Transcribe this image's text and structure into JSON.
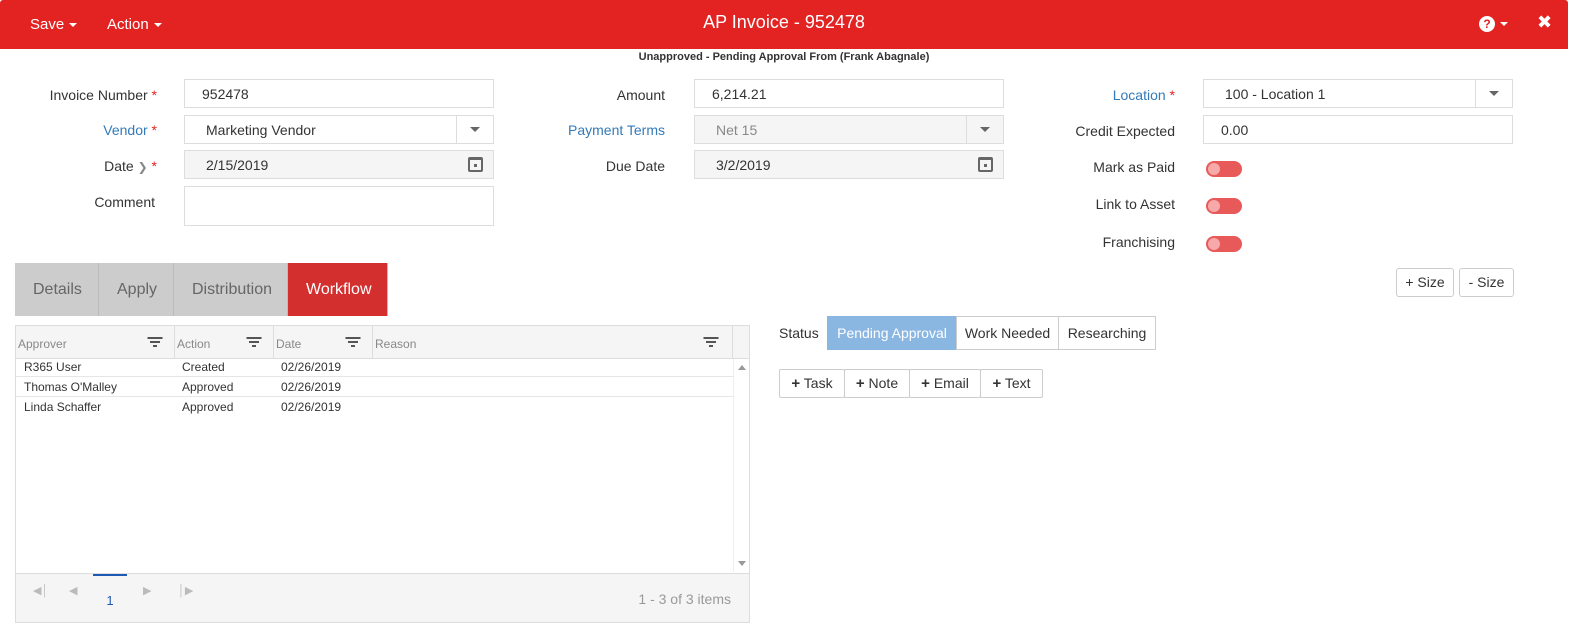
{
  "header": {
    "save_label": "Save",
    "action_label": "Action",
    "title": "AP Invoice - 952478",
    "help_glyph": "?",
    "close_glyph": "✖"
  },
  "status_line": "Unapproved - Pending Approval From (Frank Abagnale)",
  "form": {
    "invoice_number_label": "Invoice Number",
    "invoice_number": "952478",
    "vendor_label": "Vendor",
    "vendor": "Marketing Vendor",
    "date_label": "Date",
    "date": "2/15/2019",
    "comment_label": "Comment",
    "comment": "",
    "amount_label": "Amount",
    "amount": "6,214.21",
    "payment_terms_label": "Payment Terms",
    "payment_terms": "Net 15",
    "due_date_label": "Due Date",
    "due_date": "3/2/2019",
    "location_label": "Location",
    "location": "100 - Location 1",
    "credit_expected_label": "Credit Expected",
    "credit_expected": "0.00",
    "mark_as_paid_label": "Mark as Paid",
    "link_to_asset_label": "Link to Asset",
    "franchising_label": "Franchising",
    "required_mark": "*",
    "toggles": {
      "mark_as_paid": false,
      "link_to_asset": false,
      "franchising": false
    }
  },
  "size_buttons": {
    "plus": "+ Size",
    "minus": "- Size"
  },
  "tabs": [
    {
      "label": "Details"
    },
    {
      "label": "Apply"
    },
    {
      "label": "Distribution"
    },
    {
      "label": "Workflow",
      "active": true
    }
  ],
  "grid": {
    "columns": [
      "Approver",
      "Action",
      "Date",
      "Reason"
    ],
    "rows": [
      {
        "approver": "R365 User",
        "action": "Created",
        "date": "02/26/2019",
        "reason": ""
      },
      {
        "approver": "Thomas O'Malley",
        "action": "Approved",
        "date": "02/26/2019",
        "reason": ""
      },
      {
        "approver": "Linda Schaffer",
        "action": "Approved",
        "date": "02/26/2019",
        "reason": ""
      }
    ],
    "pager": {
      "current_page": "1",
      "info": "1 - 3 of 3 items"
    }
  },
  "workflow_status": {
    "label": "Status",
    "options": [
      "Pending Approval",
      "Work Needed",
      "Researching"
    ],
    "active": "Pending Approval"
  },
  "actions": {
    "task": "Task",
    "note": "Note",
    "email": "Email",
    "text": "Text"
  },
  "colors": {
    "header_red": "#e32222",
    "tab_active": "#d32f2f",
    "link_blue": "#337ab7",
    "status_active": "#8ab6e2"
  }
}
